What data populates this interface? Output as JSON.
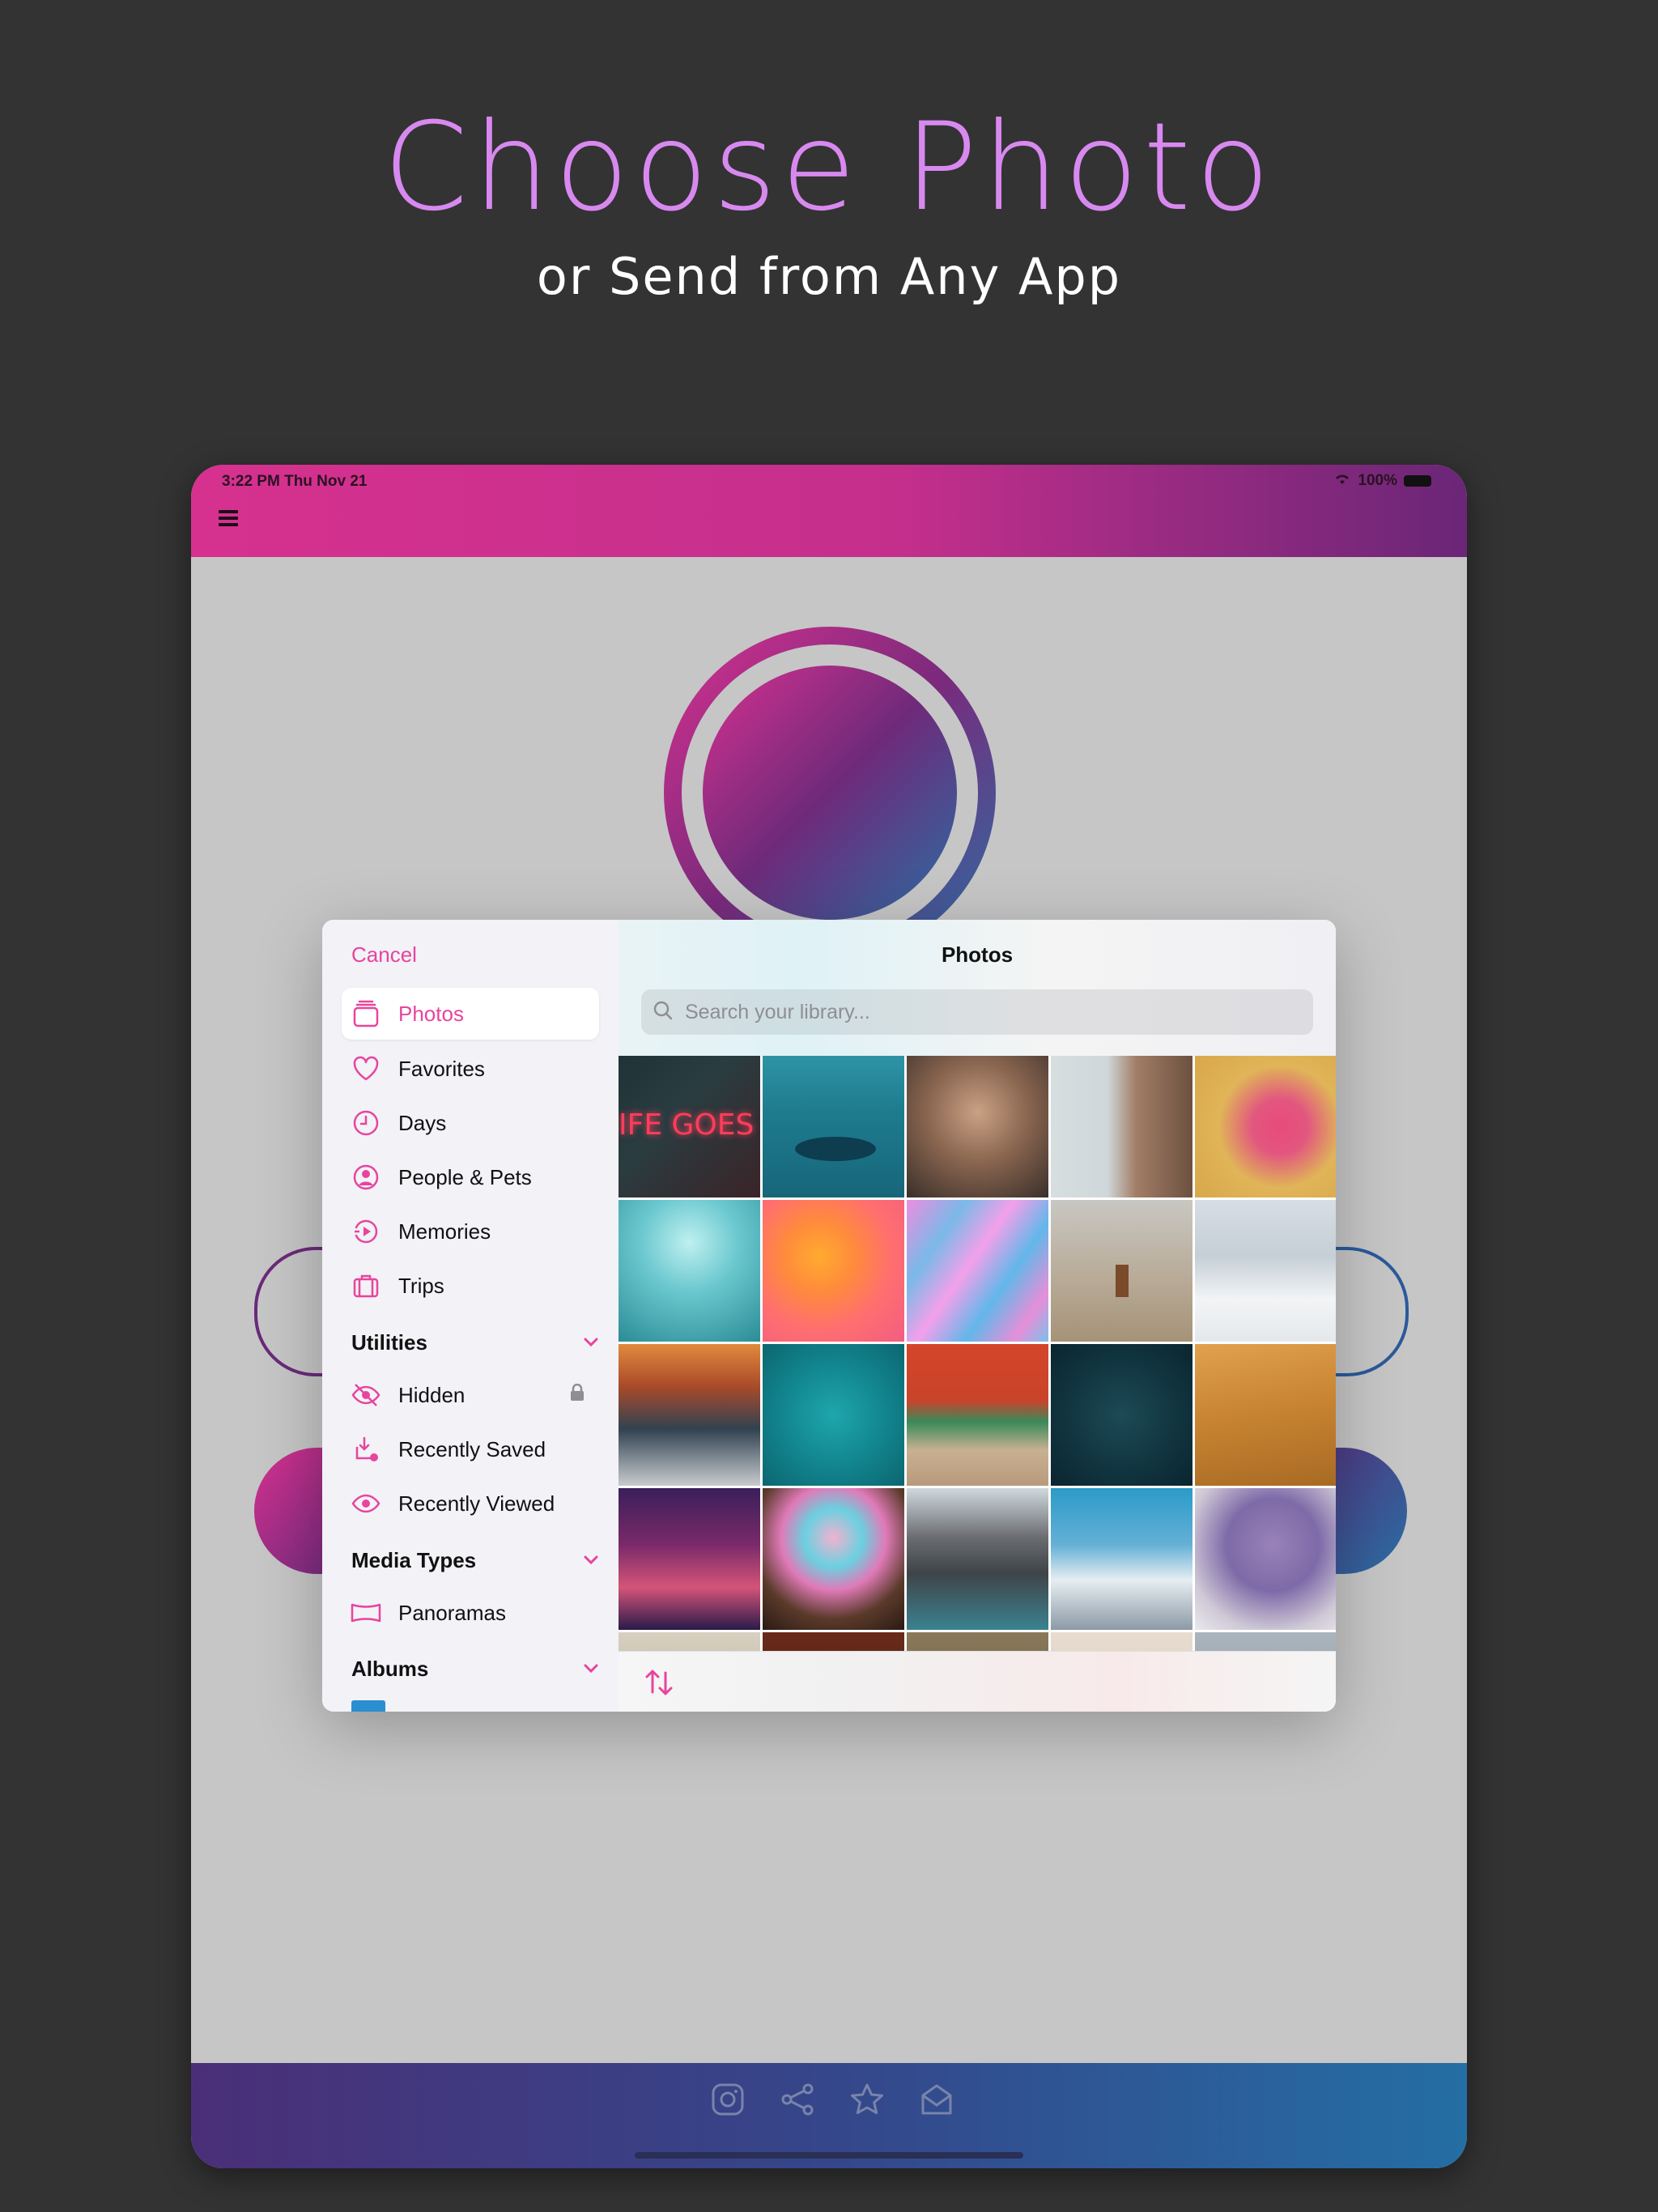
{
  "promo": {
    "title": "Choose Photo",
    "subtitle": "or Send from Any App"
  },
  "status_bar": {
    "time": "3:22 PM   Thu Nov 21",
    "battery": "100%"
  },
  "colors": {
    "accent": "#e8449e",
    "headline": "#d889f0",
    "background": "#333333"
  },
  "picker": {
    "cancel_label": "Cancel",
    "title": "Photos",
    "search_placeholder": "Search your library...",
    "sidebar": {
      "items": [
        {
          "label": "Photos",
          "icon": "photos-icon"
        },
        {
          "label": "Favorites",
          "icon": "heart-icon"
        },
        {
          "label": "Days",
          "icon": "clock-icon"
        },
        {
          "label": "People & Pets",
          "icon": "person-icon"
        },
        {
          "label": "Memories",
          "icon": "memories-icon"
        },
        {
          "label": "Trips",
          "icon": "suitcase-icon"
        }
      ],
      "utilities_header": "Utilities",
      "utilities": [
        {
          "label": "Hidden",
          "icon": "eye-slash-icon"
        },
        {
          "label": "Recently Saved",
          "icon": "download-icon"
        },
        {
          "label": "Recently Viewed",
          "icon": "eye-icon"
        }
      ],
      "media_types_header": "Media Types",
      "media_types": [
        {
          "label": "Panoramas",
          "icon": "panorama-icon"
        }
      ],
      "albums_header": "Albums"
    },
    "thumbnails": [
      "neon-sign-photo",
      "whale-photo",
      "woman-portrait-photo",
      "boy-eye-photo",
      "pink-toys-photo",
      "chill-neon-photo",
      "jellyfish-photo",
      "marble-swirl-photo",
      "chair-desert-photo",
      "snow-trees-photo",
      "sunset-coast-photo",
      "aerial-ocean-photo",
      "red-house-photo",
      "fish-school-photo",
      "sand-dunes-photo",
      "night-sky-photo",
      "colorful-hair-photo",
      "mountain-peaks-photo",
      "matterhorn-photo",
      "purple-hair-photo",
      "partial-1-photo",
      "partial-2-photo",
      "partial-3-photo",
      "partial-4-photo",
      "partial-5-photo"
    ]
  },
  "toolbar_icons": [
    "instagram-icon",
    "share-icon",
    "star-icon",
    "mail-icon"
  ]
}
